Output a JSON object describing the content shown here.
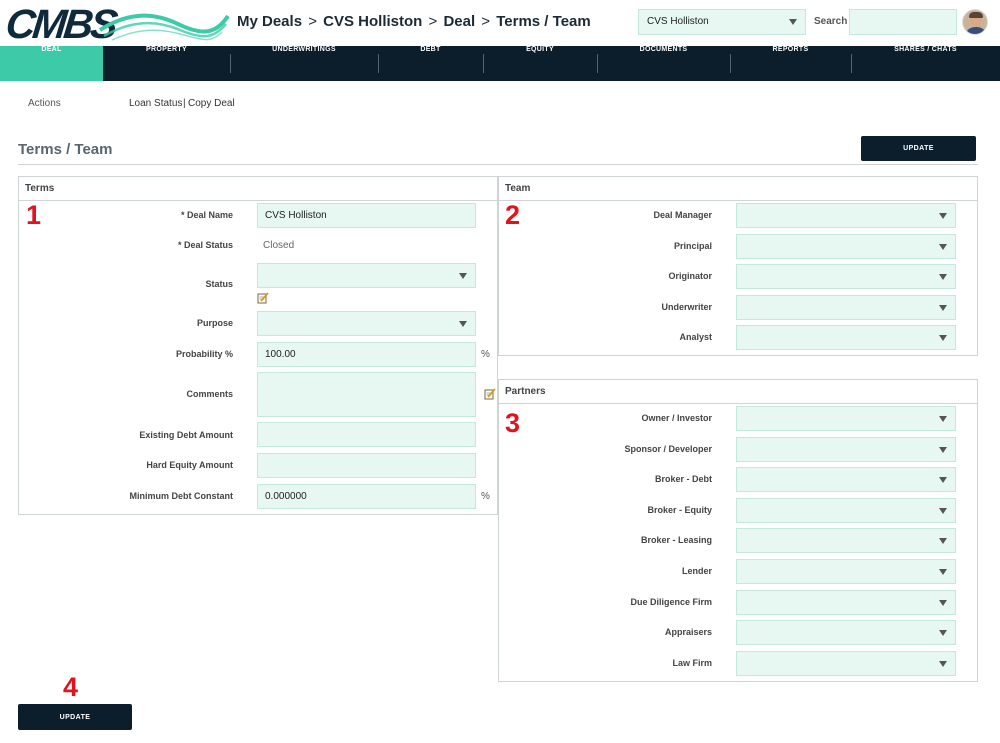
{
  "header": {
    "logo_text": "CMBS",
    "breadcrumb": [
      "My Deals",
      "CVS Holliston",
      "Deal",
      "Terms / Team"
    ],
    "breadcrumb_sep": ">",
    "deal_selector": "CVS Holliston",
    "search_label": "Search",
    "search_value": "",
    "brand_color": "#0e2a3c",
    "wave_color": "#3ccaa8"
  },
  "nav": {
    "items": [
      "DEAL",
      "PROPERTY",
      "UNDERWRITINGS",
      "DEBT",
      "EQUITY",
      "DOCUMENTS",
      "REPORTS",
      "SHARES / CHATS"
    ],
    "active": "DEAL",
    "active_color": "#3ccaa8",
    "background_color": "#0c1e2c"
  },
  "actions": {
    "label": "Actions",
    "links": [
      "Loan Status",
      "Copy Deal"
    ],
    "separator": "|"
  },
  "page": {
    "title": "Terms / Team",
    "update_top": "UPDATE",
    "update_bottom": "UPDATE"
  },
  "markers": [
    "1",
    "2",
    "3",
    "4"
  ],
  "terms": {
    "heading": "Terms",
    "deal_name_label": "* Deal Name",
    "deal_name_value": "CVS Holliston",
    "deal_status_label": "* Deal Status",
    "deal_status_value": "Closed",
    "status_label": "Status",
    "status_value": "",
    "purpose_label": "Purpose",
    "purpose_value": "",
    "probability_label": "Probability %",
    "probability_value": "100.00",
    "probability_unit": "%",
    "comments_label": "Comments",
    "comments_value": "",
    "existing_debt_label": "Existing Debt Amount",
    "existing_debt_value": "",
    "hard_equity_label": "Hard Equity Amount",
    "hard_equity_value": "",
    "min_debt_constant_label": "Minimum Debt Constant",
    "min_debt_constant_value": "0.000000",
    "min_debt_constant_unit": "%",
    "edit_icon": "edit-note-icon"
  },
  "team": {
    "heading": "Team",
    "fields": [
      "Deal Manager",
      "Principal",
      "Originator",
      "Underwriter",
      "Analyst"
    ]
  },
  "partners": {
    "heading": "Partners",
    "fields": [
      "Owner / Investor",
      "Sponsor / Developer",
      "Broker - Debt",
      "Broker - Equity",
      "Broker - Leasing",
      "Lender",
      "Due Diligence Firm",
      "Appraisers",
      "Law Firm"
    ]
  },
  "colors": {
    "input_fill": "#e6f8f1",
    "marker_red": "#e0141e"
  }
}
